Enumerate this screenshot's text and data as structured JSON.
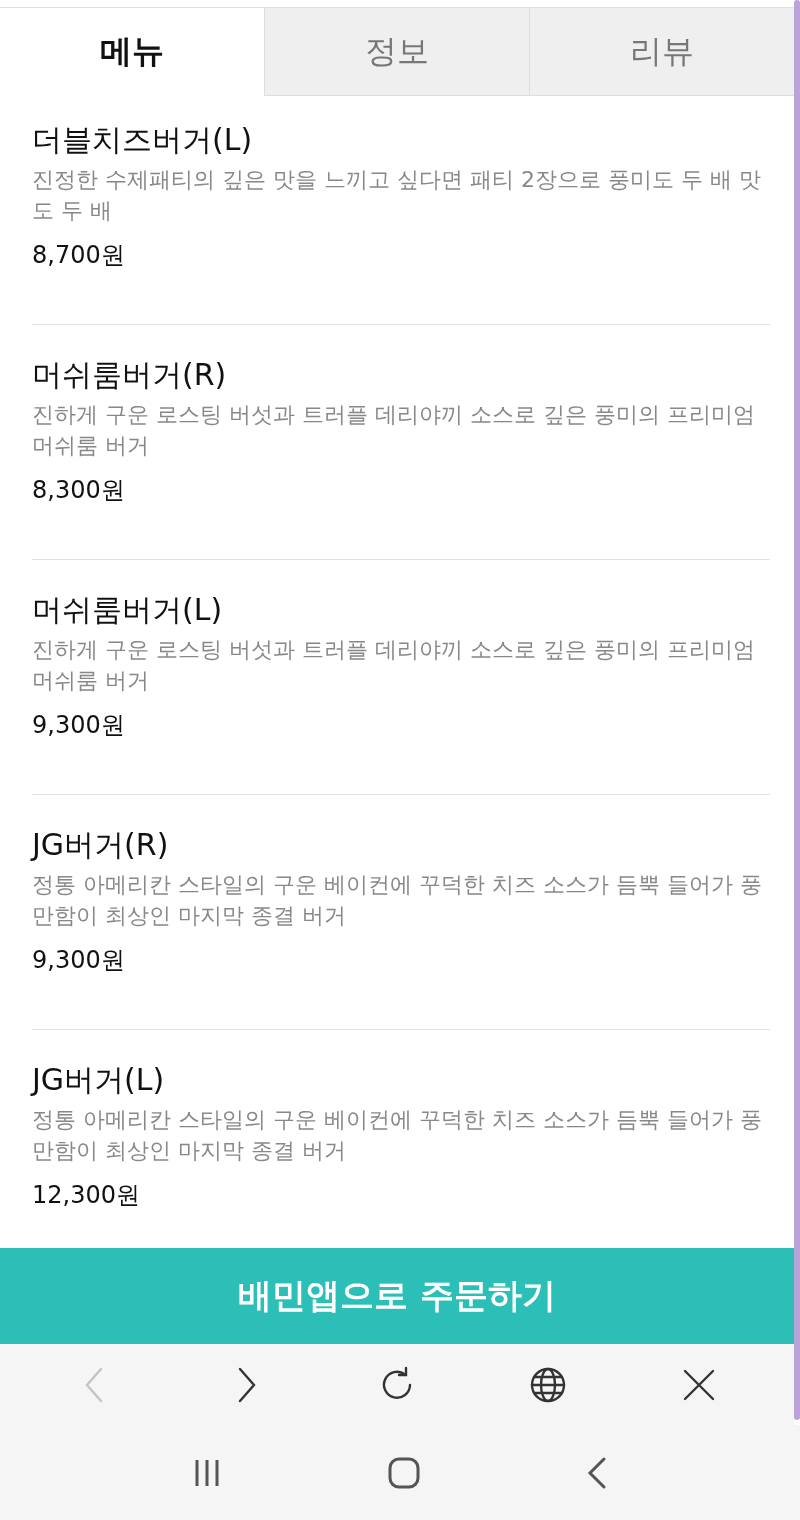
{
  "tabs": [
    {
      "label": "메뉴",
      "selected": true
    },
    {
      "label": "정보",
      "selected": false
    },
    {
      "label": "리뷰",
      "selected": false
    }
  ],
  "menu_items": [
    {
      "name": "더블치즈버거(L)",
      "description": "진정한 수제패티의 깊은 맛을 느끼고 싶다면 패티 2장으로 풍미도 두 배 맛도 두 배",
      "price": "8,700원"
    },
    {
      "name": "머쉬룸버거(R)",
      "description": "진하게 구운 로스팅 버섯과 트러플 데리야끼 소스로 깊은 풍미의 프리미엄 머쉬룸 버거",
      "price": "8,300원"
    },
    {
      "name": "머쉬룸버거(L)",
      "description": "진하게 구운 로스팅 버섯과 트러플 데리야끼 소스로 깊은 풍미의 프리미엄 머쉬룸 버거",
      "price": "9,300원"
    },
    {
      "name": "JG버거(R)",
      "description": "정통 아메리칸 스타일의 구운 베이컨에 꾸덕한 치즈 소스가 듬뿍 들어가 풍만함이 최상인 마지막 종결 버거",
      "price": "9,300원"
    },
    {
      "name": "JG버거(L)",
      "description": "정통 아메리칸 스타일의 구운 베이컨에 꾸덕한 치즈 소스가 듬뿍 들어가 풍만함이 최상인 마지막 종결 버거",
      "price": "12,300원"
    }
  ],
  "order_button": "배민앱으로 주문하기",
  "browser_toolbar": [
    {
      "kind": "back",
      "disabled": true
    },
    {
      "kind": "forward",
      "disabled": false
    },
    {
      "kind": "reload",
      "disabled": false
    },
    {
      "kind": "globe",
      "disabled": false
    },
    {
      "kind": "close",
      "disabled": false
    }
  ]
}
